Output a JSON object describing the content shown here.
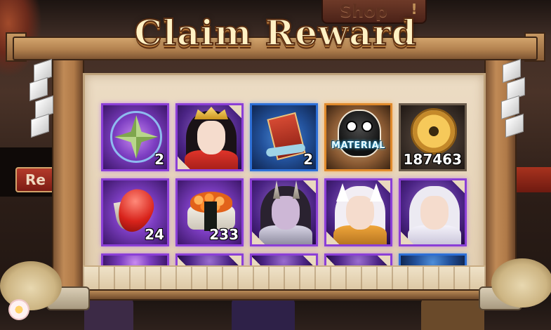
{
  "screen": {
    "title": "Claim Reward"
  },
  "background": {
    "shop_label": "Shop",
    "side_tab_label": "Re"
  },
  "rewards": {
    "row1": [
      {
        "name": "pinwheel",
        "rarity": "purple",
        "count": "2"
      },
      {
        "name": "crowned shikigami portrait",
        "rarity": "purple",
        "count": ""
      },
      {
        "name": "ticket scroll",
        "rarity": "blue",
        "count": "2"
      },
      {
        "name": "daruma material",
        "rarity": "orange",
        "count": "",
        "label": "MATERIAL"
      },
      {
        "name": "gold coin",
        "rarity": "dark",
        "count": "187463"
      }
    ],
    "row2": [
      {
        "name": "red magatama",
        "rarity": "purple",
        "count": "24"
      },
      {
        "name": "salmon roe sushi",
        "rarity": "purple",
        "count": "233"
      },
      {
        "name": "horned shikigami portrait",
        "rarity": "purple",
        "count": ""
      },
      {
        "name": "fox-eared shikigami portrait",
        "rarity": "purple",
        "count": ""
      },
      {
        "name": "white-haired shikigami portrait",
        "rarity": "purple",
        "count": ""
      }
    ],
    "row3_partial_count": 5
  },
  "colors": {
    "rarity_purple": "#8b3fd6",
    "rarity_blue": "#2d6fd6",
    "rarity_orange": "#e08a2c",
    "title_fill": "#fff1c4",
    "title_outline": "#5a2e12"
  }
}
